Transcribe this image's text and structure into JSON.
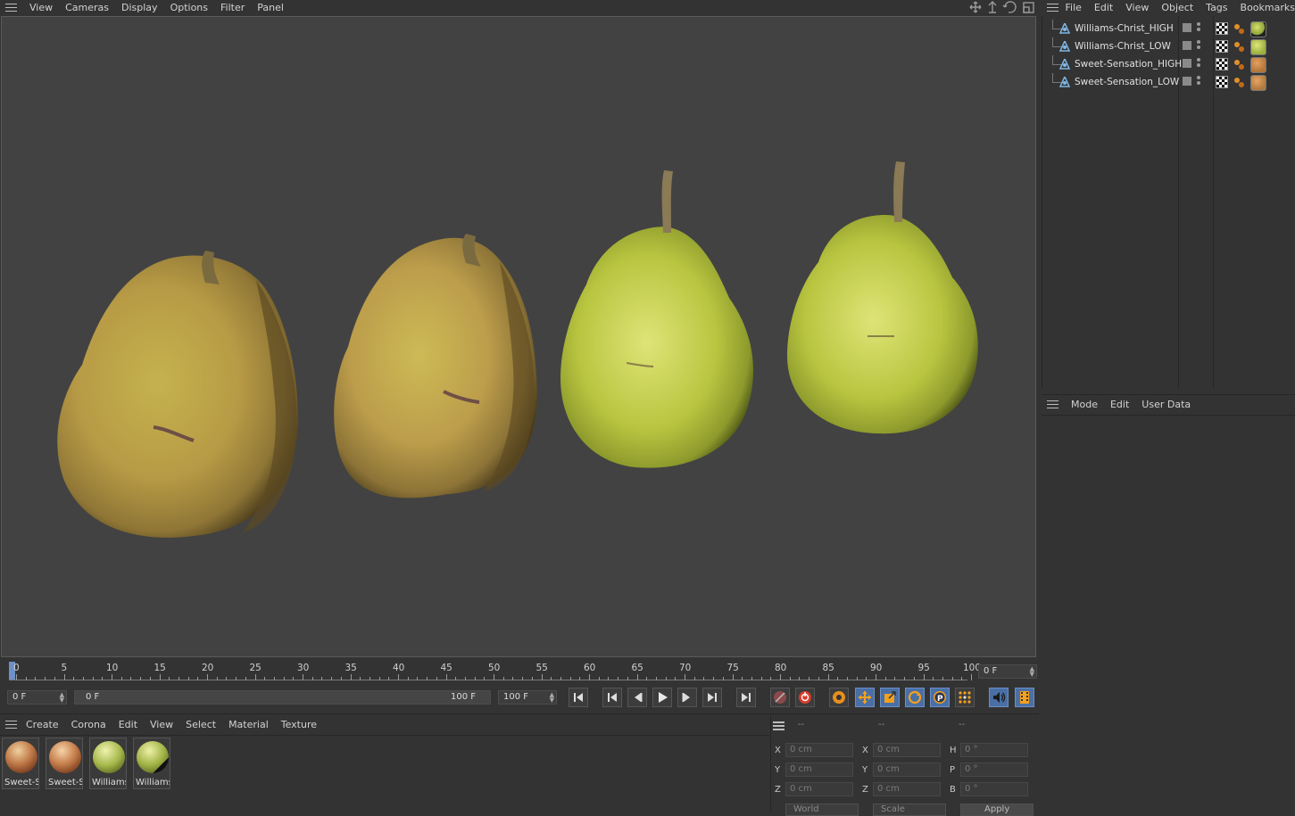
{
  "viewport_menu": [
    "View",
    "Cameras",
    "Display",
    "Options",
    "Filter",
    "Panel"
  ],
  "object_menu": [
    "File",
    "Edit",
    "View",
    "Object",
    "Tags",
    "Bookmarks"
  ],
  "objects": [
    {
      "name": "Williams-Christ_HIGH",
      "material_color": "#8aa23a"
    },
    {
      "name": "Williams-Christ_LOW",
      "material_color": "#9ab03e"
    },
    {
      "name": "Sweet-Sensation_HIGH",
      "material_color": "#b2763a"
    },
    {
      "name": "Sweet-Sensation_LOW",
      "material_color": "#b07a3e"
    }
  ],
  "attr_menu": [
    "Mode",
    "Edit",
    "User Data"
  ],
  "timeline": {
    "ticks": [
      "0",
      "5",
      "10",
      "15",
      "20",
      "25",
      "30",
      "35",
      "40",
      "45",
      "50",
      "55",
      "60",
      "65",
      "70",
      "75",
      "80",
      "85",
      "90",
      "95",
      "100"
    ],
    "current_frame": "0 F",
    "start_field": "0 F",
    "range_start": "0 F",
    "range_end": "100 F",
    "end_field": "100 F"
  },
  "material_menu": [
    "Create",
    "Corona",
    "Edit",
    "View",
    "Select",
    "Material",
    "Texture"
  ],
  "materials": [
    {
      "label": "Sweet-Se",
      "color": "#c07a48"
    },
    {
      "label": "Sweet-Se",
      "color": "#c8804e"
    },
    {
      "label": "Williams",
      "color": "#a6b84a"
    },
    {
      "label": "Williams",
      "color": "#a0b244"
    }
  ],
  "coords": {
    "header": [
      "--",
      "--",
      "--"
    ],
    "rows": [
      {
        "pos_label": "X",
        "pos": "0 cm",
        "size_label": "X",
        "size": "0 cm",
        "rot_label": "H",
        "rot": "0 °"
      },
      {
        "pos_label": "Y",
        "pos": "0 cm",
        "size_label": "Y",
        "size": "0 cm",
        "rot_label": "P",
        "rot": "0 °"
      },
      {
        "pos_label": "Z",
        "pos": "0 cm",
        "size_label": "Z",
        "size": "0 cm",
        "rot_label": "B",
        "rot": "0 °"
      }
    ],
    "world_label": "World",
    "scale_label": "Scale",
    "apply_label": "Apply"
  }
}
